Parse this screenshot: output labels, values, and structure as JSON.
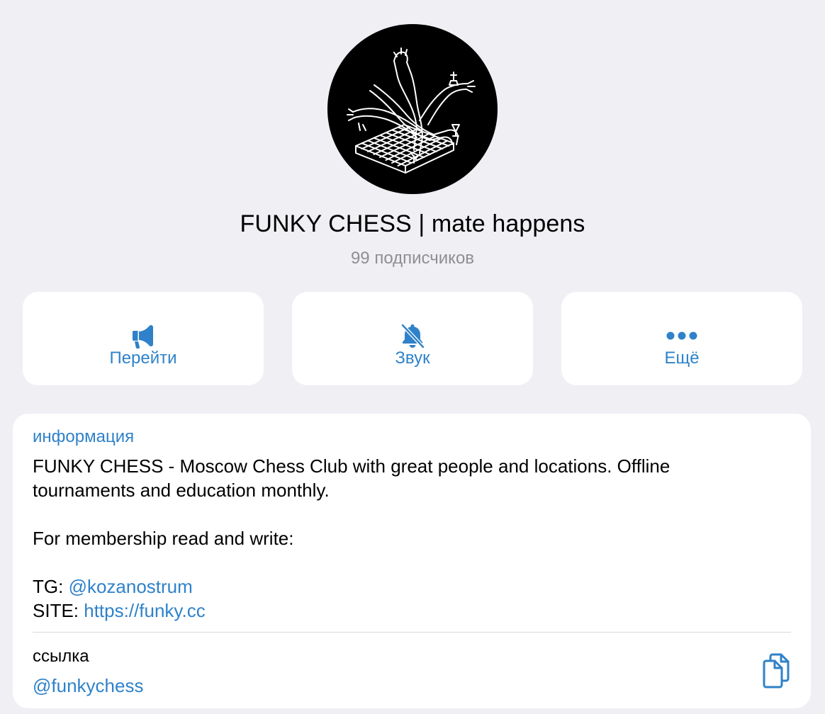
{
  "channel": {
    "title": "FUNKY CHESS | mate happens",
    "subscribers": "99 подписчиков",
    "avatar_icon": "chess-hands-board-icon"
  },
  "actions": [
    {
      "label": "Перейти",
      "icon": "megaphone-icon"
    },
    {
      "label": "Звук",
      "icon": "bell-muted-icon"
    },
    {
      "label": "Ещё",
      "icon": "more-dots-icon"
    }
  ],
  "info": {
    "label": "информация",
    "line1": "FUNKY CHESS - Moscow Chess Club with great people and locations. Offline",
    "line2": "tournaments and education monthly.",
    "line3": "For membership read and write:",
    "tg_prefix": "TG: ",
    "tg_handle": "@kozanostrum",
    "site_prefix": "SITE: ",
    "site_url": "https://funky.cc"
  },
  "link": {
    "label": "ссылка",
    "value": "@funkychess",
    "copy_icon": "copy-icon"
  },
  "colors": {
    "accent": "#2f82c9",
    "background": "#efeff4",
    "card": "#ffffff",
    "secondary_text": "#8e8e93"
  }
}
